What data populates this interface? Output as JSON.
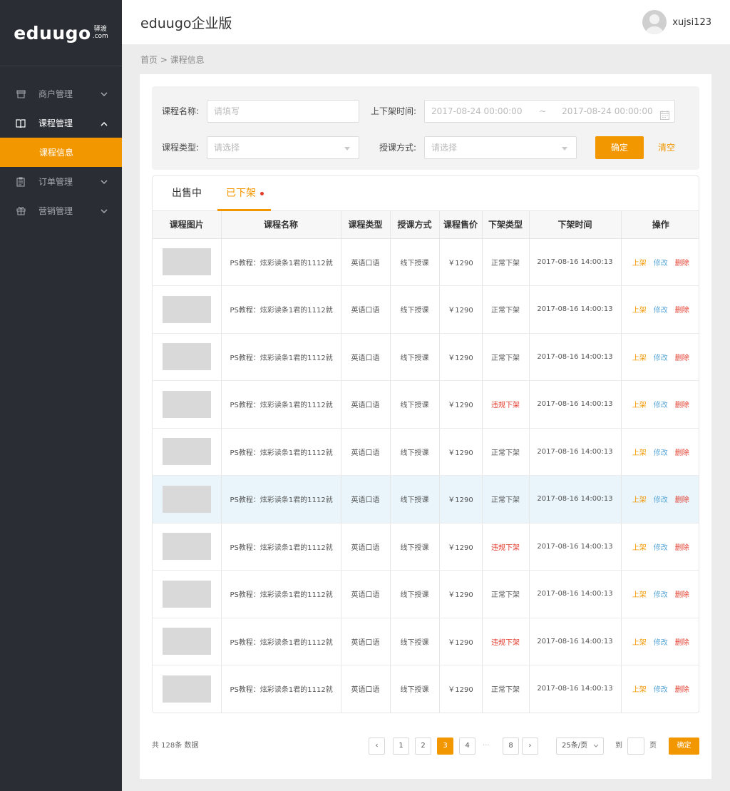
{
  "sidebar": {
    "logo": "eduugo",
    "logo_sub1": "驿渡",
    "logo_sub2": ".com",
    "menu": [
      {
        "label": "商户管理",
        "icon": "store-icon"
      },
      {
        "label": "课程管理",
        "icon": "book-icon"
      },
      {
        "label": "订单管理",
        "icon": "clipboard-icon"
      },
      {
        "label": "营销管理",
        "icon": "gift-icon"
      }
    ],
    "active_sub": "课程信息"
  },
  "header": {
    "title": "eduugo企业版",
    "username": "xujsi123"
  },
  "breadcrumb": "首页 > 课程信息",
  "filter": {
    "name_label": "课程名称:",
    "name_placeholder": "请填写",
    "time_label": "上下架时间:",
    "time_start": "2017-08-24 00:00:00",
    "time_sep": "~",
    "time_end": "2017-08-24 00:00:00",
    "type_label": "课程类型:",
    "type_placeholder": "请选择",
    "mode_label": "授课方式:",
    "mode_placeholder": "请选择",
    "confirm": "确定",
    "clear": "清空"
  },
  "tabs": [
    "出售中",
    "已下架"
  ],
  "table": {
    "headers": [
      "课程图片",
      "课程名称",
      "课程类型",
      "授课方式",
      "课程售价",
      "下架类型",
      "下架时间",
      "操作"
    ],
    "rows": [
      {
        "name": "PS教程：炫彩读条1君的1112就",
        "type": "英语口语",
        "mode": "线下授课",
        "price": "￥1290",
        "offtype": "正常下架",
        "red": false,
        "time": "2017-08-16  14:00:13"
      },
      {
        "name": "PS教程：炫彩读条1君的1112就",
        "type": "英语口语",
        "mode": "线下授课",
        "price": "￥1290",
        "offtype": "正常下架",
        "red": false,
        "time": "2017-08-16  14:00:13"
      },
      {
        "name": "PS教程：炫彩读条1君的1112就",
        "type": "英语口语",
        "mode": "线下授课",
        "price": "￥1290",
        "offtype": "正常下架",
        "red": false,
        "time": "2017-08-16  14:00:13"
      },
      {
        "name": "PS教程：炫彩读条1君的1112就",
        "type": "英语口语",
        "mode": "线下授课",
        "price": "￥1290",
        "offtype": "违规下架",
        "red": true,
        "time": "2017-08-16  14:00:13"
      },
      {
        "name": "PS教程：炫彩读条1君的1112就",
        "type": "英语口语",
        "mode": "线下授课",
        "price": "￥1290",
        "offtype": "正常下架",
        "red": false,
        "time": "2017-08-16  14:00:13"
      },
      {
        "name": "PS教程：炫彩读条1君的1112就",
        "type": "英语口语",
        "mode": "线下授课",
        "price": "￥1290",
        "offtype": "正常下架",
        "red": false,
        "time": "2017-08-16  14:00:13"
      },
      {
        "name": "PS教程：炫彩读条1君的1112就",
        "type": "英语口语",
        "mode": "线下授课",
        "price": "￥1290",
        "offtype": "违规下架",
        "red": true,
        "time": "2017-08-16  14:00:13"
      },
      {
        "name": "PS教程：炫彩读条1君的1112就",
        "type": "英语口语",
        "mode": "线下授课",
        "price": "￥1290",
        "offtype": "正常下架",
        "red": false,
        "time": "2017-08-16  14:00:13"
      },
      {
        "name": "PS教程：炫彩读条1君的1112就",
        "type": "英语口语",
        "mode": "线下授课",
        "price": "￥1290",
        "offtype": "违规下架",
        "red": true,
        "time": "2017-08-16  14:00:13"
      },
      {
        "name": "PS教程：炫彩读条1君的1112就",
        "type": "英语口语",
        "mode": "线下授课",
        "price": "￥1290",
        "offtype": "正常下架",
        "red": false,
        "time": "2017-08-16  14:00:13"
      }
    ],
    "actions": [
      "上架",
      "修改",
      "删除"
    ]
  },
  "pager": {
    "total": "共 128条 数据",
    "pages": [
      "1",
      "2",
      "3",
      "4"
    ],
    "ellipsis": "···",
    "last": "8",
    "prev": "‹",
    "next": "›",
    "size": "25条/页",
    "goto_label": "到",
    "page_unit": "页",
    "confirm": "确定"
  },
  "colors": {
    "accent": "#f29700",
    "sidebar_bg": "#2a2d33",
    "danger": "#e23b2c",
    "link": "#5aa7d8",
    "highlight_row": "#e9f5fb"
  }
}
